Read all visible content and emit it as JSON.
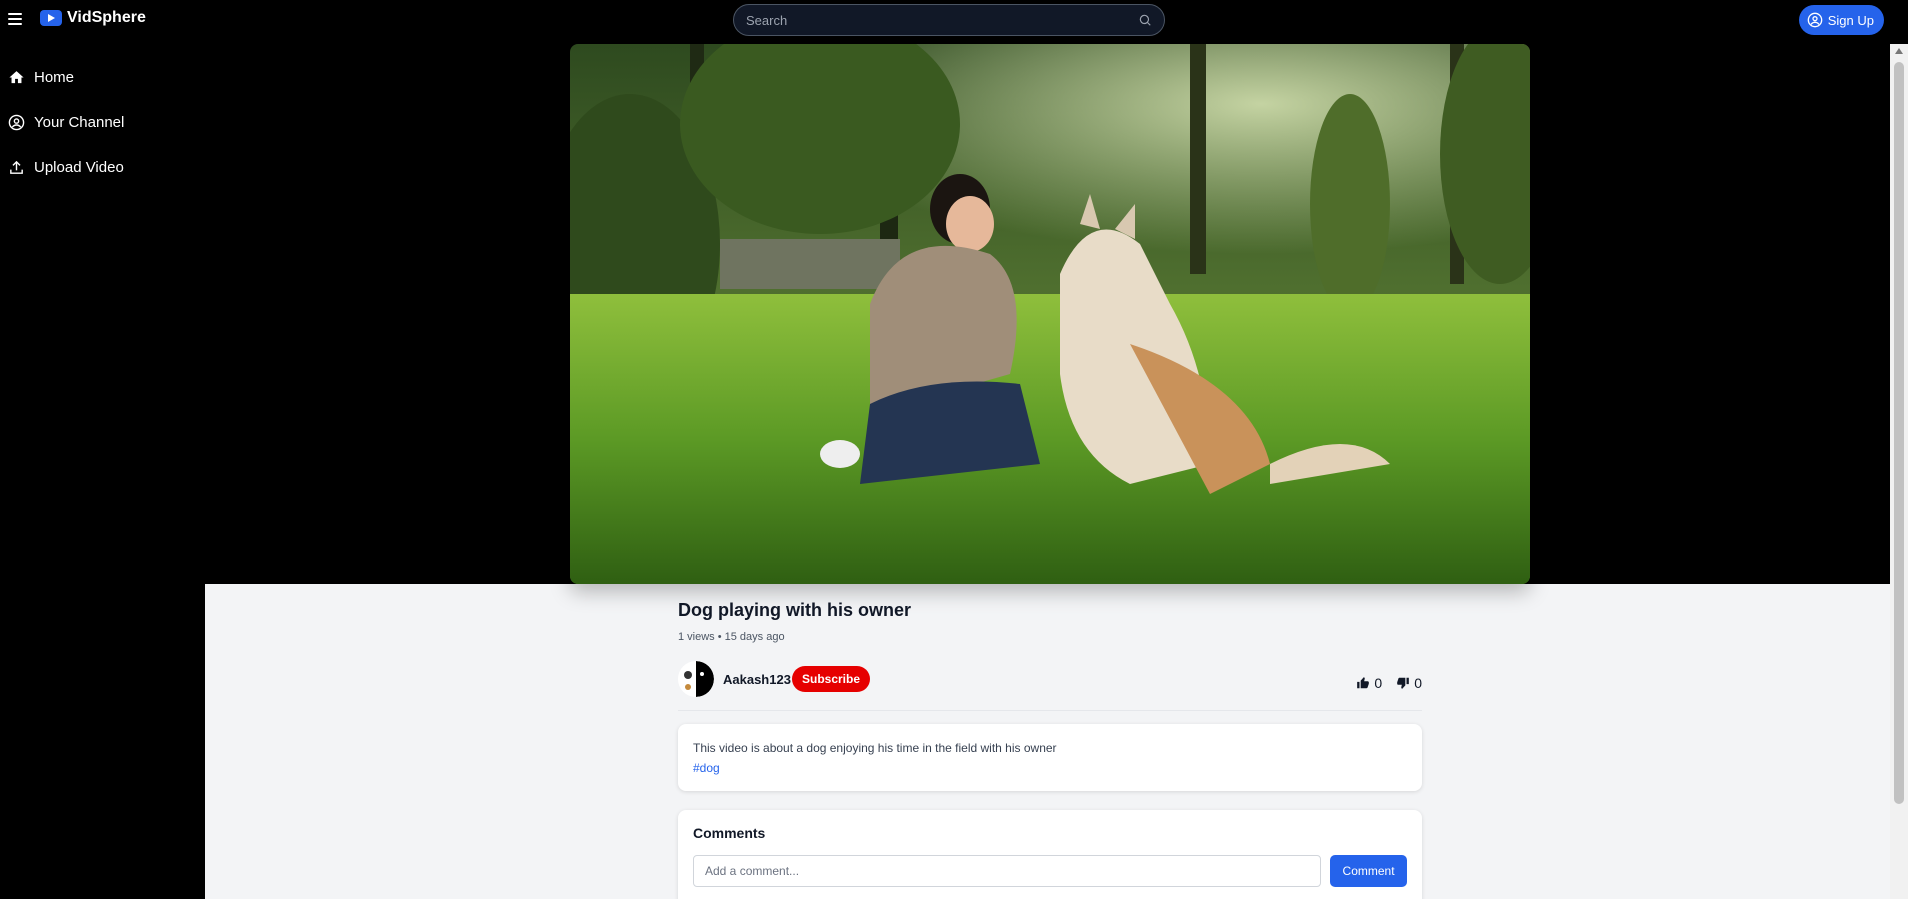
{
  "header": {
    "logo_text": "VidSphere",
    "search_placeholder": "Search",
    "signup_label": "Sign Up"
  },
  "sidebar": {
    "items": [
      {
        "label": "Home",
        "icon": "home-icon"
      },
      {
        "label": "Your Channel",
        "icon": "user-circle-icon"
      },
      {
        "label": "Upload Video",
        "icon": "upload-icon"
      }
    ]
  },
  "video": {
    "title": "Dog playing with his owner",
    "views": "1 views",
    "age": "15 days ago",
    "meta": "1 views • 15 days ago",
    "channel": "Aakash123",
    "subscribe_label": "Subscribe",
    "likes": "0",
    "dislikes": "0",
    "description": "This video is about a dog enjoying his time in the field with his owner",
    "hashtag": "#dog"
  },
  "comments": {
    "heading": "Comments",
    "placeholder": "Add a comment...",
    "button_label": "Comment"
  },
  "colors": {
    "accent": "#2563eb",
    "subscribe": "#e60000",
    "page_bg": "#f3f4f6"
  }
}
